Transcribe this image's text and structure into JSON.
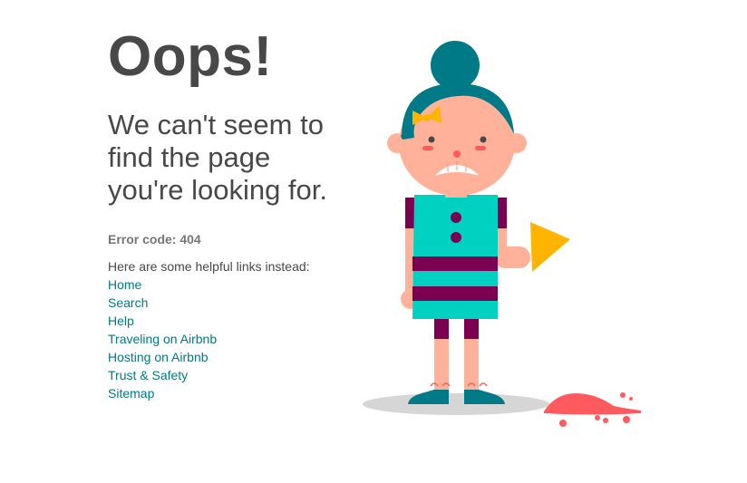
{
  "heading": "Oops!",
  "subheading": "We can't seem to find the page you're looking for.",
  "error_code": "Error code: 404",
  "helpful_text": "Here are some helpful links instead:",
  "links": [
    {
      "label": "Home"
    },
    {
      "label": "Search"
    },
    {
      "label": "Help"
    },
    {
      "label": "Traveling on Airbnb"
    },
    {
      "label": "Hosting on Airbnb"
    },
    {
      "label": "Trust & Safety"
    },
    {
      "label": "Sitemap"
    }
  ],
  "colors": {
    "text": "#484848",
    "muted": "#767676",
    "link": "#007a87",
    "hair": "#00838f",
    "dress": "#00d1c1",
    "stripe": "#7b0051",
    "skin": "#ffb199",
    "ice_cream": "#ff5a5f",
    "cone": "#ffb400"
  },
  "illustration": {
    "icon": "sad-girl-dropped-ice-cream-icon"
  }
}
